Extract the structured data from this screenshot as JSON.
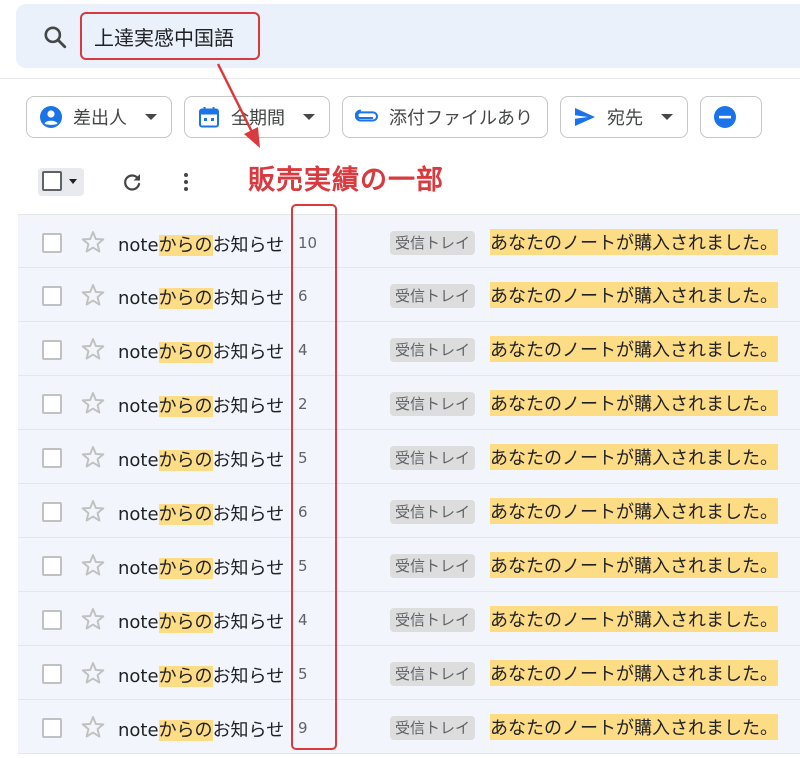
{
  "search": {
    "query": "上達実感中国語"
  },
  "filters": [
    {
      "label": "差出人",
      "icon": "person-icon",
      "color": "#1a73e8"
    },
    {
      "label": "全期間",
      "icon": "calendar-icon",
      "color": "#1a73e8"
    },
    {
      "label": "添付ファイルあり",
      "icon": "paperclip-icon",
      "color": "#1a73e8"
    },
    {
      "label": "宛先",
      "icon": "send-icon",
      "color": "#1a73e8"
    },
    {
      "label": "",
      "icon": "minus-circle-icon",
      "color": "#1a73e8"
    }
  ],
  "annotation": {
    "label": "販売実績の一部",
    "color": "#d93a3f"
  },
  "messages": [
    {
      "sender_pre": "note",
      "sender_hl": "からの",
      "sender_post": "お知らせ",
      "count": "10",
      "label": "受信トレイ",
      "subject": "あなたのノートが購入されました。"
    },
    {
      "sender_pre": "note",
      "sender_hl": "からの",
      "sender_post": "お知らせ",
      "count": "6",
      "label": "受信トレイ",
      "subject": "あなたのノートが購入されました。"
    },
    {
      "sender_pre": "note",
      "sender_hl": "からの",
      "sender_post": "お知らせ",
      "count": "4",
      "label": "受信トレイ",
      "subject": "あなたのノートが購入されました。"
    },
    {
      "sender_pre": "note",
      "sender_hl": "からの",
      "sender_post": "お知らせ",
      "count": "2",
      "label": "受信トレイ",
      "subject": "あなたのノートが購入されました。"
    },
    {
      "sender_pre": "note",
      "sender_hl": "からの",
      "sender_post": "お知らせ",
      "count": "5",
      "label": "受信トレイ",
      "subject": "あなたのノートが購入されました。"
    },
    {
      "sender_pre": "note",
      "sender_hl": "からの",
      "sender_post": "お知らせ",
      "count": "6",
      "label": "受信トレイ",
      "subject": "あなたのノートが購入されました。"
    },
    {
      "sender_pre": "note",
      "sender_hl": "からの",
      "sender_post": "お知らせ",
      "count": "5",
      "label": "受信トレイ",
      "subject": "あなたのノートが購入されました。"
    },
    {
      "sender_pre": "note",
      "sender_hl": "からの",
      "sender_post": "お知らせ",
      "count": "4",
      "label": "受信トレイ",
      "subject": "あなたのノートが購入されました。"
    },
    {
      "sender_pre": "note",
      "sender_hl": "からの",
      "sender_post": "お知らせ",
      "count": "5",
      "label": "受信トレイ",
      "subject": "あなたのノートが購入されました。"
    },
    {
      "sender_pre": "note",
      "sender_hl": "からの",
      "sender_post": "お知らせ",
      "count": "9",
      "label": "受信トレイ",
      "subject": "あなたのノートが購入されました。"
    }
  ]
}
